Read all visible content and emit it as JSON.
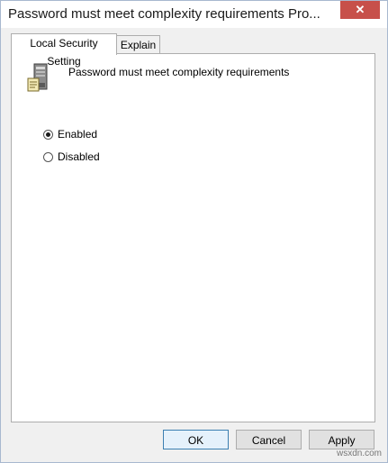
{
  "window": {
    "title": "Password must meet complexity requirements Pro...",
    "close_symbol": "✕"
  },
  "tabs": [
    {
      "label": "Local Security Setting",
      "active": true
    },
    {
      "label": "Explain",
      "active": false
    }
  ],
  "policy": {
    "icon": "server-policy-icon",
    "name": "Password must meet complexity requirements"
  },
  "options": [
    {
      "label": "Enabled",
      "selected": true
    },
    {
      "label": "Disabled",
      "selected": false
    }
  ],
  "buttons": {
    "ok": "OK",
    "cancel": "Cancel",
    "apply": "Apply"
  },
  "watermark": "wsxdn.com",
  "colors": {
    "close_button": "#c7504a",
    "default_button_border": "#3c7fb1"
  }
}
